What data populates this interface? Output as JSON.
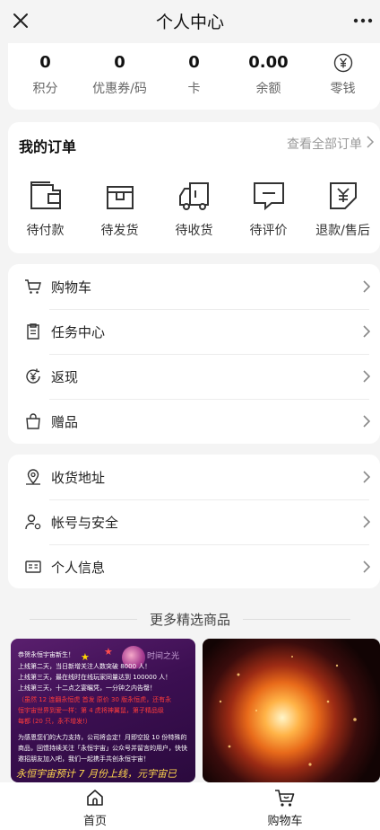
{
  "header": {
    "title": "个人中心"
  },
  "stats": [
    {
      "value": "0",
      "label": "积分"
    },
    {
      "value": "0",
      "label": "优惠券/码"
    },
    {
      "value": "0",
      "label": "卡"
    },
    {
      "value": "0.00",
      "label": "余额"
    },
    {
      "icon": "yen-circle-icon",
      "label": "零钱"
    }
  ],
  "orders": {
    "title": "我的订单",
    "view_all": "查看全部订单",
    "items": [
      {
        "label": "待付款",
        "icon": "wallet-icon"
      },
      {
        "label": "待发货",
        "icon": "package-icon"
      },
      {
        "label": "待收货",
        "icon": "truck-icon"
      },
      {
        "label": "待评价",
        "icon": "comment-icon"
      },
      {
        "label": "退款/售后",
        "icon": "refund-icon"
      }
    ]
  },
  "menu1": [
    {
      "label": "购物车",
      "icon": "cart-icon"
    },
    {
      "label": "任务中心",
      "icon": "clipboard-icon"
    },
    {
      "label": "返现",
      "icon": "cashback-icon"
    },
    {
      "label": "赠品",
      "icon": "gift-bag-icon"
    }
  ],
  "menu2": [
    {
      "label": "收货地址",
      "icon": "location-icon"
    },
    {
      "label": "帐号与安全",
      "icon": "account-security-icon"
    },
    {
      "label": "个人信息",
      "icon": "id-card-icon"
    }
  ],
  "section": {
    "more_title": "更多精选商品"
  },
  "product1": {
    "lines": [
      "恭贺永恒宇宙新生！",
      "上线第二天，当日新增关注人数突破 8000 人！",
      "上线第三天，最在线时在线玩家同量达到 100000 人！",
      "上线第三天，十二点之宴瞩凭，一分钟之内告罄！",
      "（虽然 12 连翻永恒虎 首发 原价 30 版永恒虎，还有永",
      "恒宇宙世界到爱一样：第 4 虎将神翼鼠，第子精品级",
      "每都 (20 只，永不增发!）",
      "为感恩您们的大力支持，公司将会定！月即空投 10 份特殊的",
      "商品，回馈持续关注「永恒宇宙」公众号并留言的用户，快快",
      "邀招朋友加入吧，我们一起携手共创永恒宇宙！"
    ],
    "banner": "永恒宇宙预计 7 月份上线，元宇宙已",
    "logo_text": "时间之光"
  },
  "tabbar": [
    {
      "label": "首页",
      "icon": "home-icon"
    },
    {
      "label": "购物车",
      "icon": "cart-icon"
    }
  ]
}
